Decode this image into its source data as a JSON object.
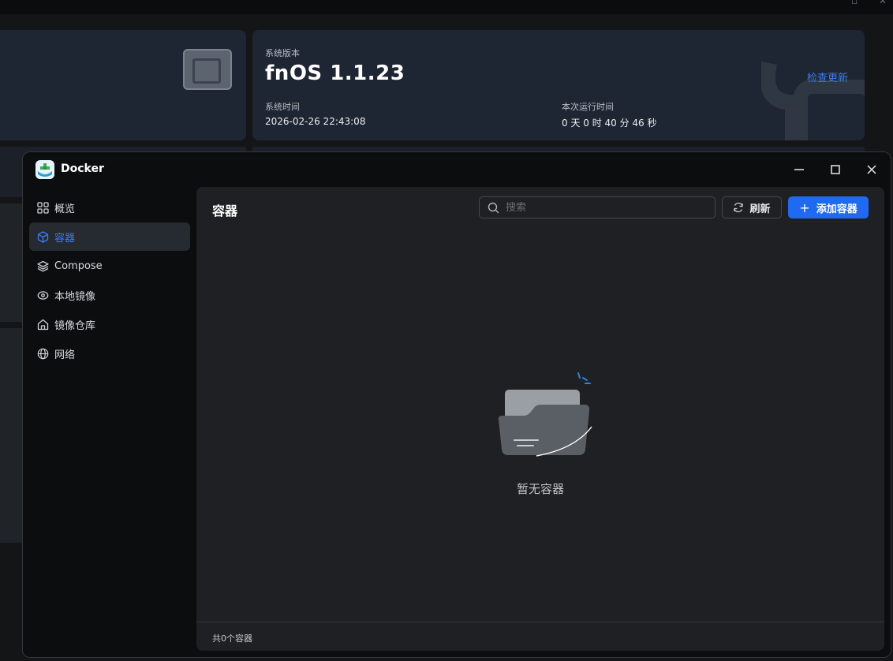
{
  "desktop": {
    "system_version_label": "系统版本",
    "system_version": "fnOS  1.1.23",
    "check_update": "检查更新",
    "system_time_label": "系统时间",
    "system_time": "2026-02-26 22:43:08",
    "uptime_label": "本次运行时间",
    "uptime": "0 天 0 时 40 分 46 秒"
  },
  "window": {
    "title": "Docker",
    "controls": [
      "minimize",
      "maximize",
      "close"
    ]
  },
  "sidebar": {
    "items": [
      {
        "label": "概览",
        "icon": "grid-icon",
        "active": false
      },
      {
        "label": "容器",
        "icon": "cube-icon",
        "active": true
      },
      {
        "label": "Compose",
        "icon": "layers-icon",
        "active": false
      },
      {
        "label": "本地镜像",
        "icon": "eye-disc-icon",
        "active": false
      },
      {
        "label": "镜像仓库",
        "icon": "home-icon",
        "active": false
      },
      {
        "label": "网络",
        "icon": "globe-icon",
        "active": false
      }
    ]
  },
  "main": {
    "title": "容器",
    "search_placeholder": "搜索",
    "search_value": "",
    "refresh_label": "刷新",
    "add_label": "添加容器",
    "empty_text": "暂无容器",
    "footer_count": "共0个容器"
  },
  "colors": {
    "accent": "#1f6af0",
    "link": "#3d7cf2",
    "content_bg": "#1f2023",
    "sidebar_bg": "#0c0d0e"
  }
}
